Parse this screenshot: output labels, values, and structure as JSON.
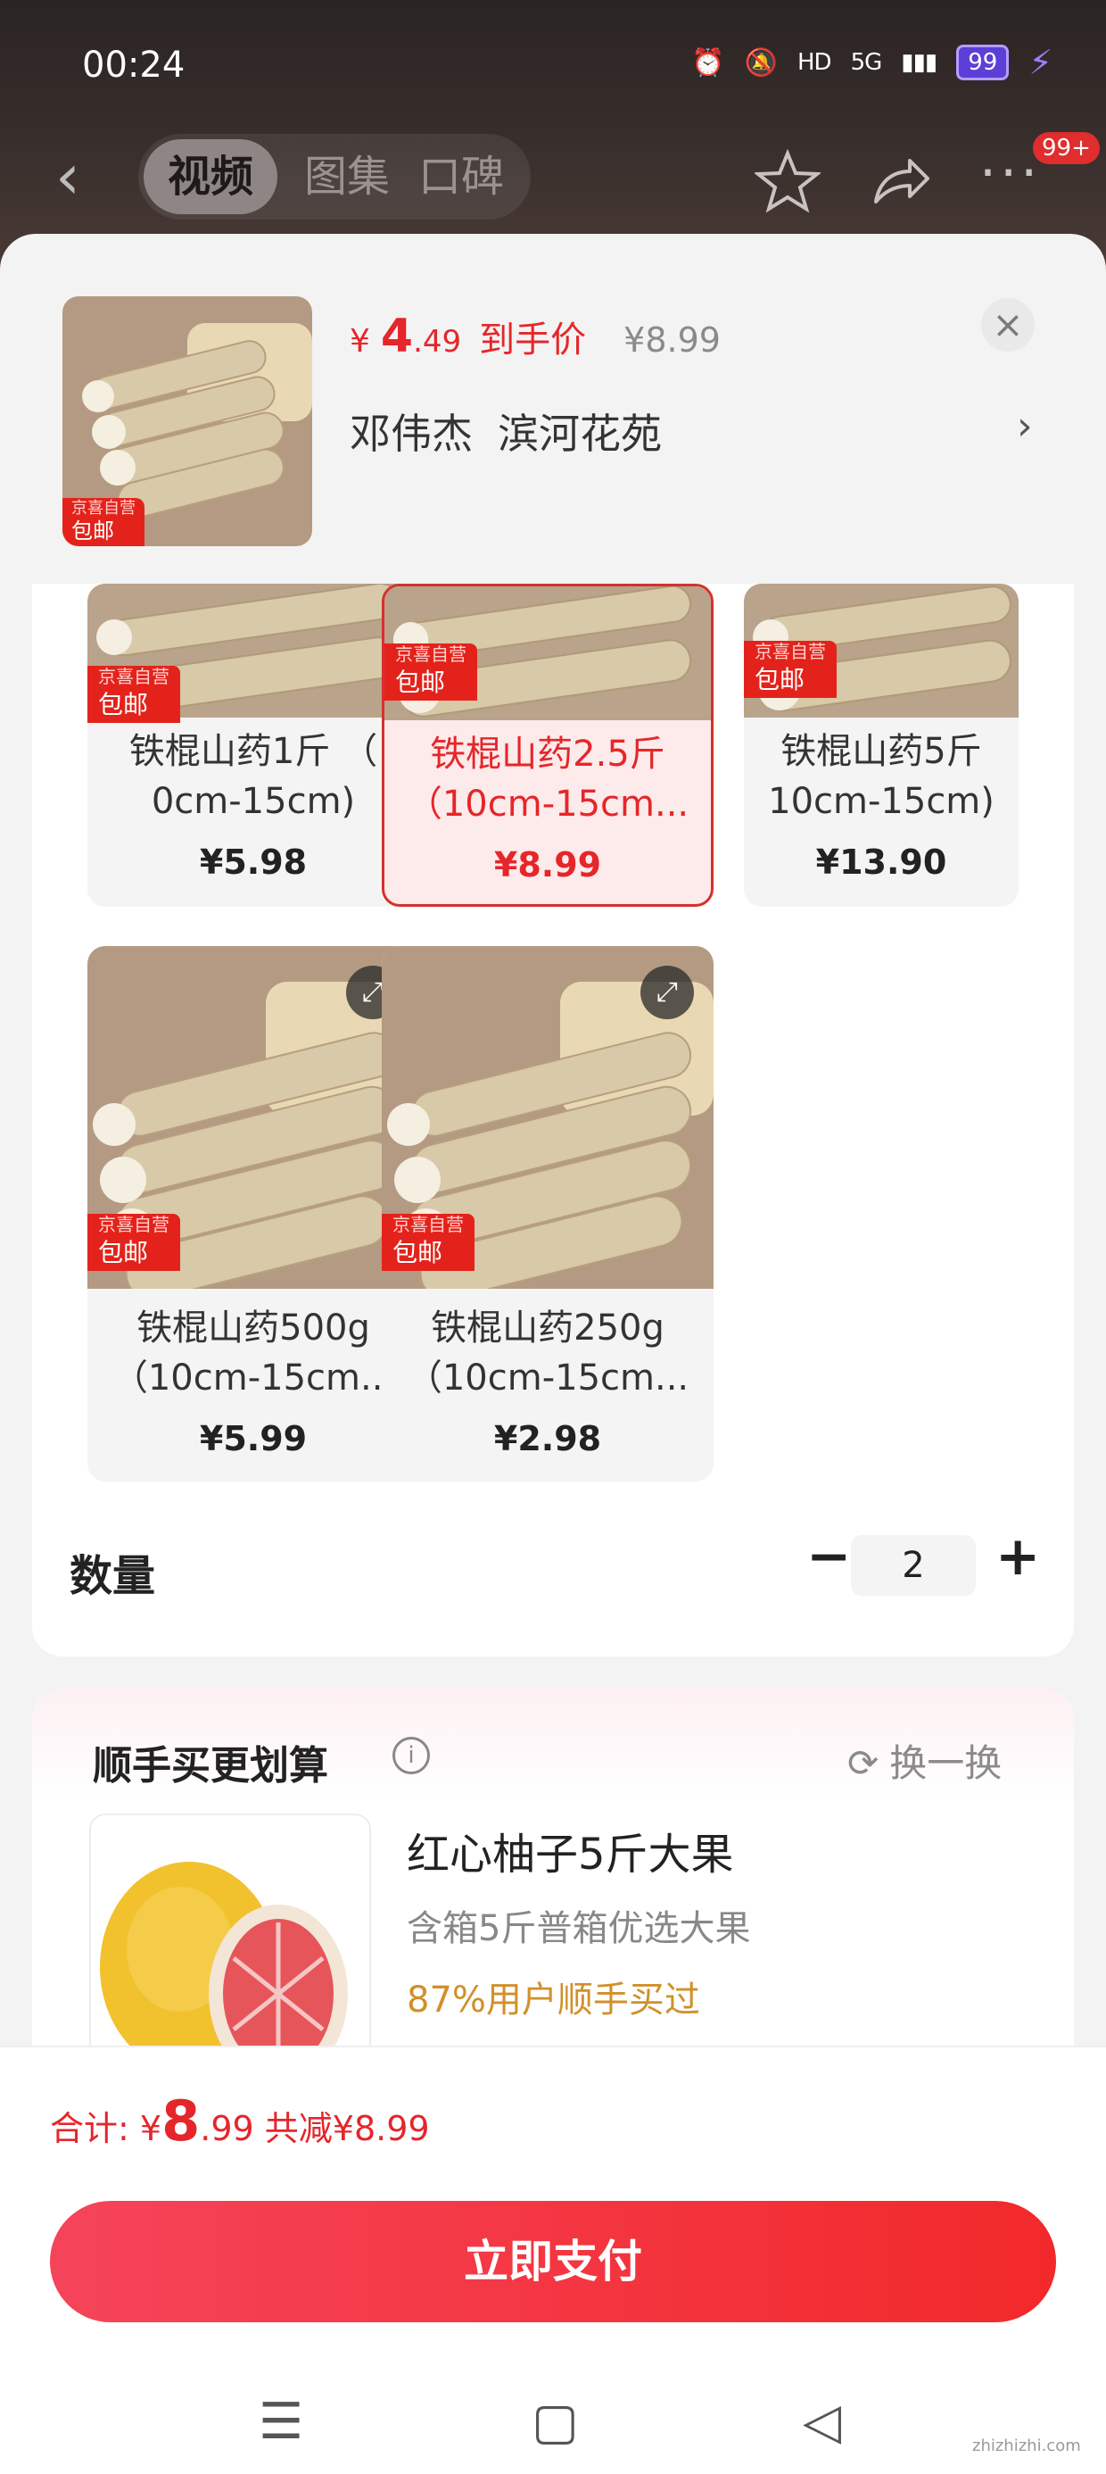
{
  "status_bar": {
    "time": "00:24",
    "network": "5G",
    "battery": "99"
  },
  "nav": {
    "tabs": [
      {
        "label": "视频"
      },
      {
        "label": "图集"
      },
      {
        "label": "口碑"
      }
    ],
    "badge": "99+"
  },
  "header": {
    "tag_top": "京喜自营",
    "tag_bottom": "包邮",
    "price_currency": "¥",
    "price_int": "4",
    "price_dec": ".49",
    "price_label": "到手价",
    "original_price": "¥8.99",
    "address_name": "邓伟杰",
    "address_place": "滨河花苑"
  },
  "skus": [
    {
      "name_line1": "铁棍山药1斤 （",
      "name_line2": "0cm-15cm)",
      "price": "¥5.98",
      "tag_top": "京喜自营",
      "tag_bottom": "包邮"
    },
    {
      "name_line1": "铁棍山药2.5斤",
      "name_line2": "（10cm-15cm...",
      "price": "¥8.99",
      "tag_top": "京喜自营",
      "tag_bottom": "包邮",
      "selected": true
    },
    {
      "name_line1": "铁棍山药5斤",
      "name_line2": "10cm-15cm)",
      "price": "¥13.90",
      "tag_top": "京喜自营",
      "tag_bottom": "包邮"
    },
    {
      "name_line1": "铁棍山药500g",
      "name_line2": "（10cm-15cm...",
      "price": "¥5.99",
      "tag_top": "京喜自营",
      "tag_bottom": "包邮"
    },
    {
      "name_line1": "铁棍山药250g",
      "name_line2": "（10cm-15cm...",
      "price": "¥2.98",
      "tag_top": "京喜自营",
      "tag_bottom": "包邮"
    }
  ],
  "quantity": {
    "label": "数量",
    "value": "2",
    "minus": "−",
    "plus": "+"
  },
  "addon": {
    "title": "顺手买更划算",
    "refresh": "换一换",
    "product_name": "红心柚子5斤大果",
    "product_desc": "含箱5斤普箱优选大果",
    "product_stat": "87%用户顺手买过"
  },
  "footer": {
    "total_label": "合计:",
    "total_currency": "¥",
    "total_int": "8",
    "total_dec": ".99",
    "discount": "共减¥8.99",
    "pay_button": "立即支付"
  },
  "watermark": "zhizhizhi.com",
  "colors": {
    "accent": "#e5262a",
    "pay_start": "#f5445a",
    "pay_end": "#f2292a",
    "stat": "#d1902a"
  }
}
